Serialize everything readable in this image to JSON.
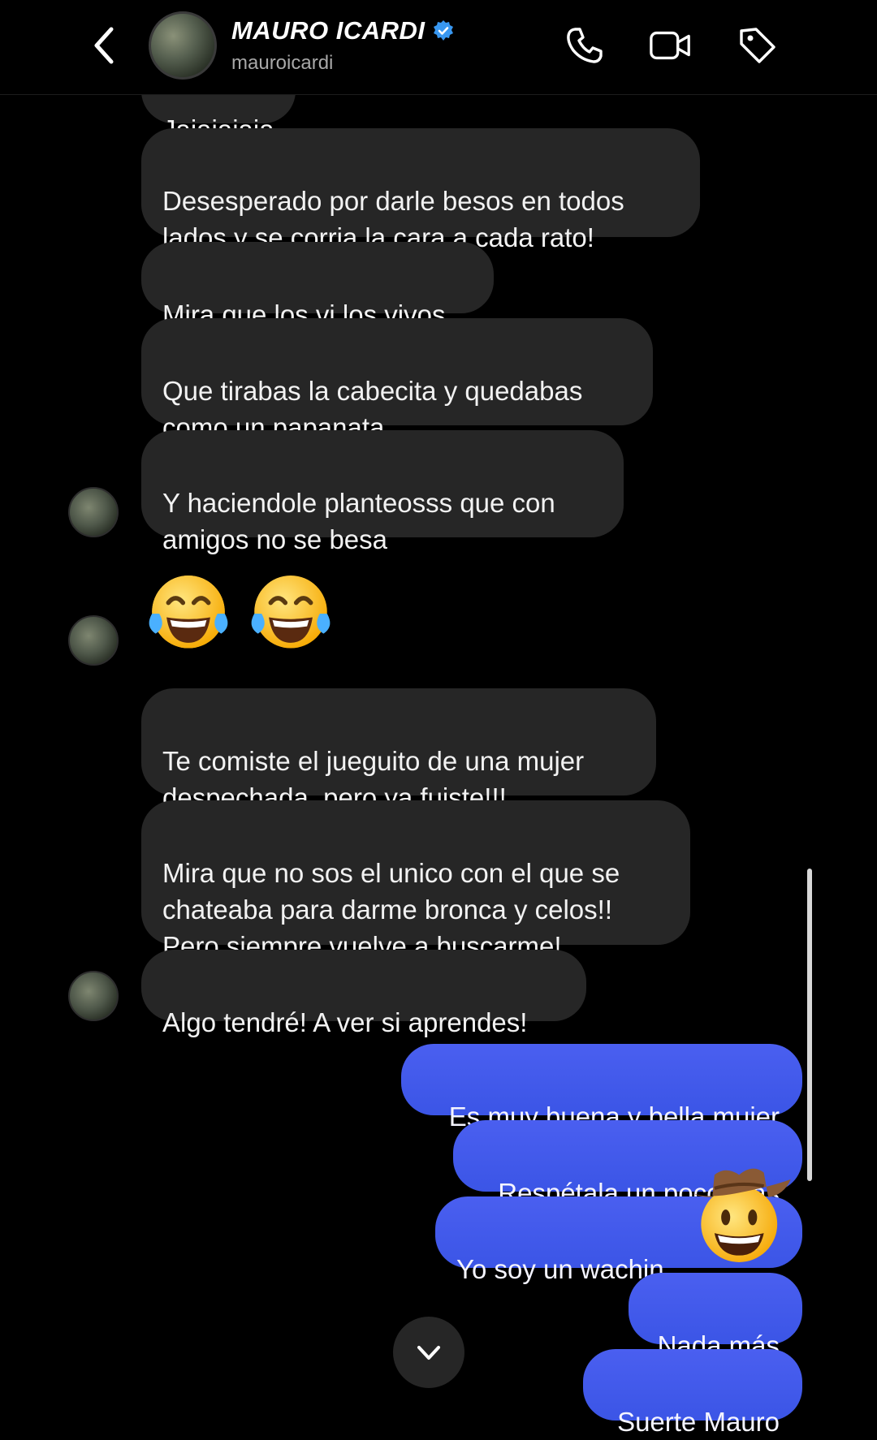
{
  "header": {
    "name": "MAURO ICARDI",
    "username": "mauroicardi",
    "icons": {
      "back": "chevron-left-icon",
      "verified": "verified-badge-icon",
      "call": "phone-icon",
      "video": "video-camera-icon",
      "tag": "tag-icon"
    },
    "accent": "#3897f0"
  },
  "messages": {
    "m0": {
      "text": "Jajajajaja",
      "direction": "in"
    },
    "m1": {
      "text": "Desesperado por darle besos en todos\nlados y se corria la cara a cada rato!",
      "direction": "in"
    },
    "m2": {
      "text": "Mira que los vi los vivos",
      "direction": "in"
    },
    "m3": {
      "text": "Que tirabas la cabecita y quedabas\ncomo un papanata",
      "direction": "in"
    },
    "m4": {
      "text": "Y haciendole planteosss que con\namigos no se besa",
      "direction": "in"
    },
    "m5": {
      "emoji": "face-with-tears-of-joy x2",
      "direction": "in"
    },
    "m6": {
      "text": "Te comiste el jueguito de una mujer\ndespechada, pero ya fuiste!!!",
      "direction": "in"
    },
    "m7": {
      "text": "Mira que no sos el unico con el que se\nchateaba para darme bronca y celos!!\nPero siempre vuelve a buscarme!",
      "direction": "in"
    },
    "m8": {
      "text": "Algo tendré! A ver si aprendes!",
      "direction": "in"
    },
    "o1": {
      "text": "Es muy buena y bella mujer",
      "direction": "out"
    },
    "o2": {
      "text": "Respétala un poco más",
      "direction": "out"
    },
    "o3": {
      "text": "Yo soy un wachin",
      "direction": "out",
      "reaction": "cowboy-hat-face"
    },
    "o4": {
      "text": "Nada más",
      "direction": "out"
    },
    "o5": {
      "text": "Suerte Mauro",
      "direction": "out"
    }
  },
  "colors": {
    "background": "#000000",
    "incoming_bubble": "#262626",
    "outgoing_bubble": "#3d5aea"
  },
  "controls": {
    "scroll_down": "chevron-down-icon"
  }
}
